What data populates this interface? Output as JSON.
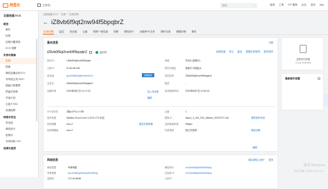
{
  "topbar": {
    "brand": "阿里云",
    "workspace": "工作台",
    "search_placeholder": "搜索...",
    "nav": [
      "费用",
      "工单",
      "ICP 备案",
      "企业",
      "支持",
      "App"
    ]
  },
  "sidebar": {
    "title": "云服务器 ECS",
    "items": [
      {
        "label": "概览",
        "type": "group"
      },
      {
        "label": "事件",
        "type": "item"
      },
      {
        "label": "标签",
        "type": "item"
      },
      {
        "label": "自助问题排查",
        "type": "item"
      },
      {
        "label": "ECS 洞察",
        "type": "item"
      },
      {
        "label": "实例与镜像",
        "type": "group"
      },
      {
        "label": "实例",
        "type": "active"
      },
      {
        "label": "镜像",
        "type": "item"
      },
      {
        "label": "弹性容器实例 ECI",
        "type": "item"
      },
      {
        "label": "专有宿主机 DDH",
        "type": "item"
      },
      {
        "label": "超级计算集群",
        "type": "item"
      },
      {
        "label": "预留实例券",
        "type": "item"
      },
      {
        "label": "节省计划",
        "type": "item"
      },
      {
        "label": "云盘 ESSD",
        "type": "item"
      },
      {
        "label": "资源保障",
        "type": "item"
      },
      {
        "label": "网络与安全",
        "type": "group"
      },
      {
        "label": "安全组",
        "type": "item"
      },
      {
        "label": "弹性网卡",
        "type": "item"
      },
      {
        "label": "密钥对",
        "type": "item"
      },
      {
        "label": "专有网络 VPC",
        "type": "item"
      },
      {
        "label": "运维与监控",
        "type": "group"
      }
    ]
  },
  "breadcrumb": [
    "云服务器 ECS",
    "/",
    "实例",
    "/",
    "实例详情"
  ],
  "instance_id": "iZ8vb6f9qt2nw94f5bpqbrZ",
  "tabs": [
    "实例详情",
    "监控",
    "安全组",
    "云盘",
    "快照一致性组",
    "快照",
    "弹性网卡",
    "远程命令/文件",
    "操作记录",
    "健康诊断",
    "事件"
  ],
  "basic": {
    "heading": "基本信息",
    "diagnose": "诊断",
    "links": [
      "诊断",
      "远程连接",
      "停止",
      "重启",
      "重置实例密码",
      "更多操作"
    ],
    "name": "iZ8vb6f9qt2nw94f5bpqbrZ",
    "status": "运行中",
    "fields_left": [
      {
        "label": "实例 ID",
        "value": "i-8vb6f9qt2nw94f5bpqbr"
      },
      {
        "label": "公网 IP",
        "value": "8.142.88.153"
      },
      {
        "label": "安全组",
        "value": "sg-8vb5k5xg9yu5hcrt0x1h"
      },
      {
        "label": "主机名",
        "value": "iZ8vb6f9qt2nw94f5bpqbrZ"
      },
      {
        "label": "创建时间",
        "value": "2023年8月7日 11:17:23"
      }
    ],
    "fields_right": [
      {
        "label": "地域",
        "value": "华北3 (张家口)"
      },
      {
        "label": "所在可用区",
        "value": "张家口 可用区A"
      },
      {
        "label": "实例名称",
        "value": "iZ8vb6f9qt2nw94f5bpqbrZ"
      },
      {
        "label": "描述",
        "value": "-"
      },
      {
        "label": "自动释放时间",
        "value": "2023年8月7日 12:30:00"
      }
    ],
    "connect_btn": "远程连接",
    "add_sg": "加入安全组",
    "edit": "编辑",
    "spec_left": [
      {
        "label": "CPU&内存",
        "value": "2核(vCPU) 4 GiB"
      },
      {
        "label": "操作系统",
        "value": "Alibaba Cloud Linux 3.2104 LTS 64位"
      },
      {
        "label": "实例规格",
        "value": "ecs.c7"
      },
      {
        "label": "实例规格族",
        "value": "ecs.c7"
      }
    ],
    "spec_right": [
      {
        "label": "云盘",
        "value": "1"
      },
      {
        "label": "镜像 ID",
        "value": "aliyun_3_x64_20G_alibase_20230727.vhd"
      },
      {
        "label": "当前使用带宽",
        "value": "5Mbps"
      },
      {
        "label": "付费类型",
        "value": "抢占式实例"
      }
    ],
    "change_image": "更换操作系统",
    "change_spec": "更改实例规格",
    "release": "释放设置"
  },
  "network": {
    "heading": "网络信息",
    "bind_btn": "绑定弹性公网IP",
    "more": "更多",
    "cols_left": [
      "网络类型",
      "专有网络",
      "交换机"
    ],
    "vals_left": [
      "专有网络",
      "vpc-8vb6ng9sw0wp0bo0lkmg",
      "172.16.88.80"
    ],
    "cols_right": [
      "弹性网卡",
      "主私网 IP",
      "公网 IP"
    ],
    "vals_right": [
      "eni-8vbbfq5q9ld1ftk3bqhq",
      "eni-8vbbfq5q9ld1ftk3bqhq",
      "-"
    ]
  },
  "side": {
    "cloud_assistant": "云助手已安装",
    "cloud_assistant_sub": "Cloud Assistant",
    "recent_events": "最新事件告警",
    "watermark": "激活 Windows",
    "watermark_sub": "转到\"设置\"以激活 Windows。"
  }
}
